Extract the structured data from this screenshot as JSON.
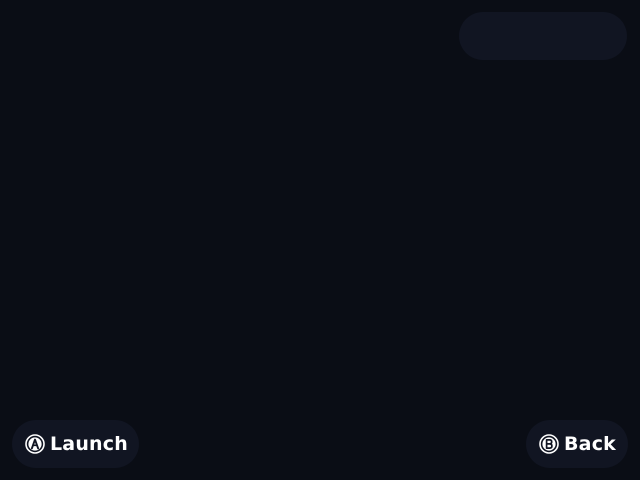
{
  "status_pill": {
    "text": ""
  },
  "footer": {
    "launch": {
      "button_icon": "a-button-icon",
      "label": "Launch"
    },
    "back": {
      "button_icon": "b-button-icon",
      "label": "Back"
    }
  },
  "colors": {
    "background": "#0a0d15",
    "pill_background": "#111522",
    "text": "#ffffff"
  }
}
